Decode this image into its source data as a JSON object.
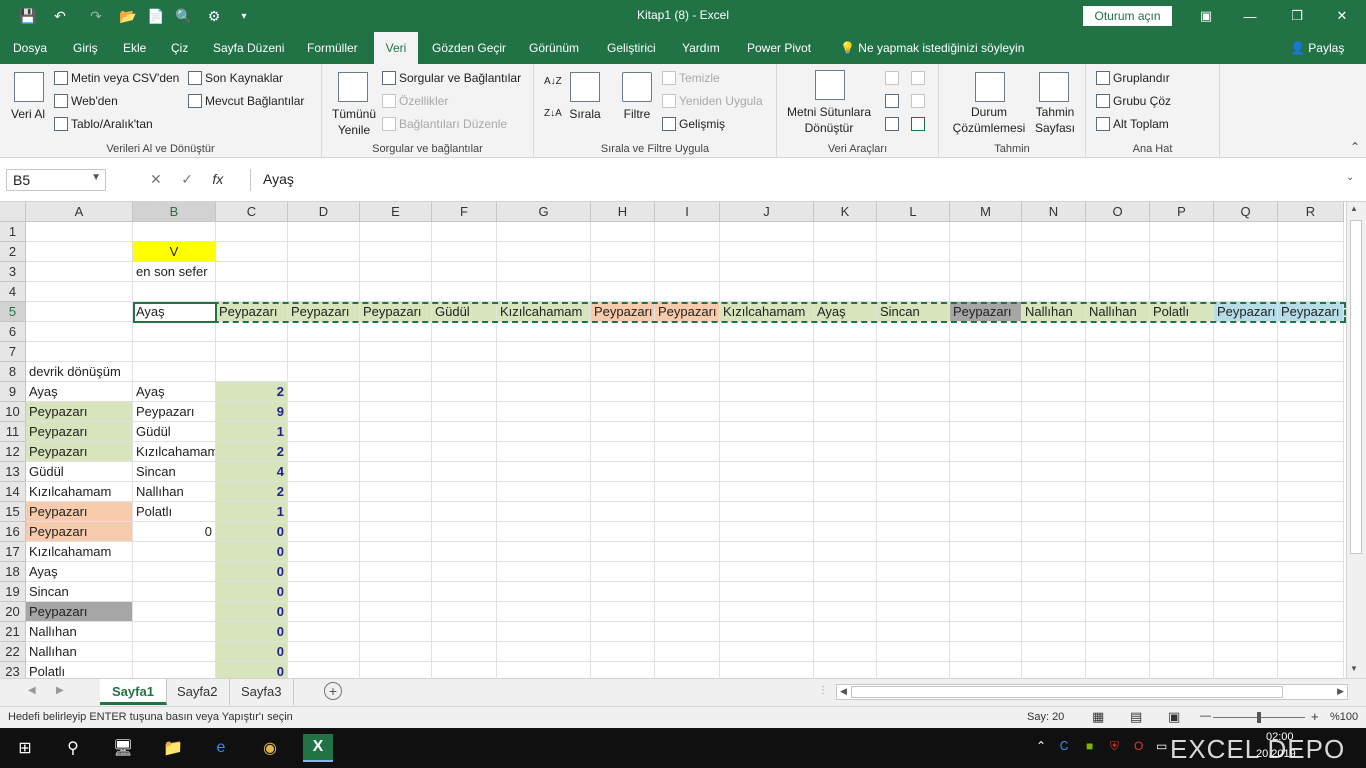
{
  "titlebar": {
    "title": "Kitap1 (8)  -  Excel",
    "signin": "Oturum açın"
  },
  "tabs": [
    "Dosya",
    "Giriş",
    "Ekle",
    "Çiz",
    "Sayfa Düzeni",
    "Formüller",
    "Veri",
    "Gözden Geçir",
    "Görünüm",
    "Geliştirici",
    "Yardım",
    "Power Pivot"
  ],
  "active_tab": "Veri",
  "tellme": "Ne yapmak istediğinizi söyleyin",
  "share": "Paylaş",
  "ribbon": {
    "get_data": {
      "big": "Veri Al",
      "items": [
        "Metin veya CSV'den",
        "Web'den",
        "Tablo/Aralık'tan",
        "Son Kaynaklar",
        "Mevcut Bağlantılar"
      ],
      "label": "Verileri Al ve Dönüştür"
    },
    "queries": {
      "big": "Tümünü Yenile",
      "items": [
        "Sorgular ve Bağlantılar",
        "Özellikler",
        "Bağlantıları Düzenle"
      ],
      "label": "Sorgular ve bağlantılar"
    },
    "sort": {
      "sort": "Sırala",
      "filter": "Filtre",
      "items": [
        "Temizle",
        "Yeniden Uygula",
        "Gelişmiş"
      ],
      "label": "Sırala ve Filtre Uygula"
    },
    "tools": {
      "big": "Metni Sütunlara Dönüştür",
      "label": "Veri Araçları"
    },
    "forecast": {
      "whatif": "Durum Çözümlemesi",
      "sheet": "Tahmin Sayfası",
      "label": "Tahmin"
    },
    "outline": {
      "items": [
        "Gruplandır",
        "Grubu Çöz",
        "Alt Toplam"
      ],
      "label": "Ana Hat"
    }
  },
  "namebox": "B5",
  "formula": "Ayaş",
  "columns": [
    "A",
    "B",
    "C",
    "D",
    "E",
    "F",
    "G",
    "H",
    "I",
    "J",
    "K",
    "L",
    "M",
    "N",
    "O",
    "P",
    "Q",
    "R"
  ],
  "rows": [
    "1",
    "2",
    "3",
    "4",
    "5",
    "6",
    "7",
    "8",
    "9",
    "10",
    "11",
    "12",
    "13",
    "14",
    "15",
    "16",
    "17",
    "18",
    "19",
    "20",
    "21",
    "22",
    "23"
  ],
  "cells": {
    "B2": "V",
    "B3": "en son sefer",
    "row5": [
      "Ayaş",
      "Peypazarı",
      "Peypazarı",
      "Peypazarı",
      "Güdül",
      "Kızılcahamam",
      "Peypazarı",
      "Peypazarı",
      "Kızılcahamam",
      "Ayaş",
      "Sincan",
      "Peypazarı",
      "Nallıhan",
      "Nallıhan",
      "Polatlı",
      "Peypazarı",
      "Peypazarı"
    ],
    "A8": "devrik dönüşüm",
    "colA": [
      "Ayaş",
      "Peypazarı",
      "Peypazarı",
      "Peypazarı",
      "Güdül",
      "Kızılcahamam",
      "Peypazarı",
      "Peypazarı",
      "Kızılcahamam",
      "Ayaş",
      "Sincan",
      "Peypazarı",
      "Nallıhan",
      "Nallıhan",
      "Polatlı"
    ],
    "colB": [
      "Ayaş",
      "Peypazarı",
      "Güdül",
      "Kızılcahamam",
      "Sincan",
      "Nallıhan",
      "Polatlı",
      "0"
    ],
    "colC": [
      "2",
      "9",
      "1",
      "2",
      "4",
      "2",
      "1",
      "0",
      "0",
      "0",
      "0",
      "0",
      "0",
      "0",
      "0"
    ]
  },
  "sheets": [
    "Sayfa1",
    "Sayfa2",
    "Sayfa3"
  ],
  "status": {
    "message": "Hedefi belirleyip ENTER tuşuna basın veya Yapıştır'ı seçin",
    "count": "Say: 20",
    "zoom": "%100"
  },
  "taskbar": {
    "time": "02:00",
    "date": "20.2019",
    "brand": "EXCEL DEPO"
  },
  "colors": {
    "excel_green": "#217346",
    "yellow": "#ffff00",
    "olive": "#d8e4bc",
    "peach": "#f8cbad",
    "gray": "#a6a6a6"
  }
}
